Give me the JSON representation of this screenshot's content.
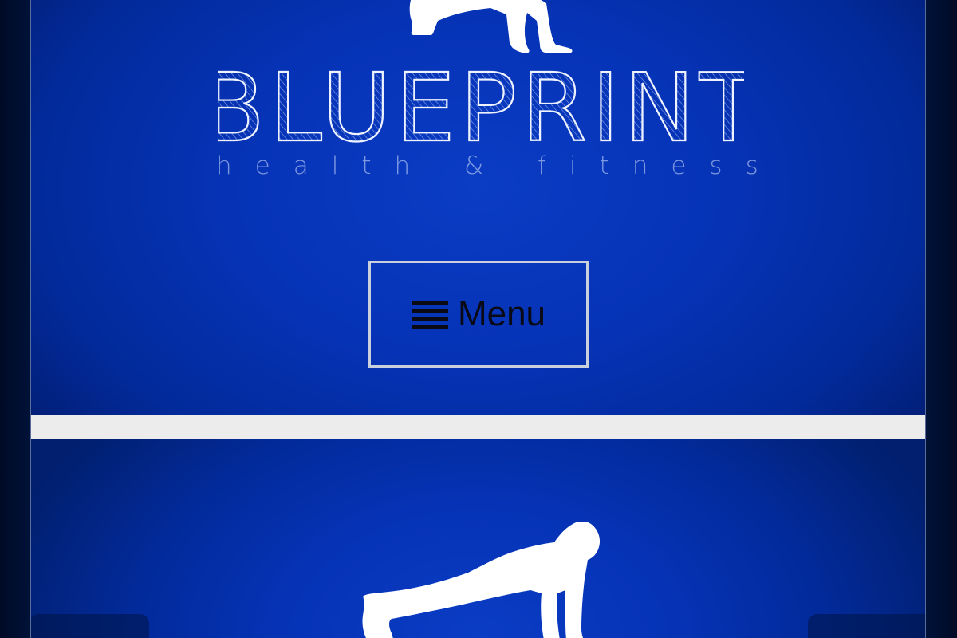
{
  "brand": {
    "name": "BLUEPRINT",
    "tagline": "health & fitness"
  },
  "navigation": {
    "menu_label": "Menu",
    "menu_icon": "hamburger-icon"
  },
  "hero": {
    "figure": "pushup-silhouette",
    "controls": {
      "prev_icon": "chevron-left-icon",
      "next_icon": "chevron-right-icon"
    }
  },
  "colors": {
    "brand_blue": "#0633b6",
    "frame_background": "#001238",
    "divider": "#ececec",
    "button_border": "#c9cfdc",
    "menu_text": "#0a0a14"
  }
}
